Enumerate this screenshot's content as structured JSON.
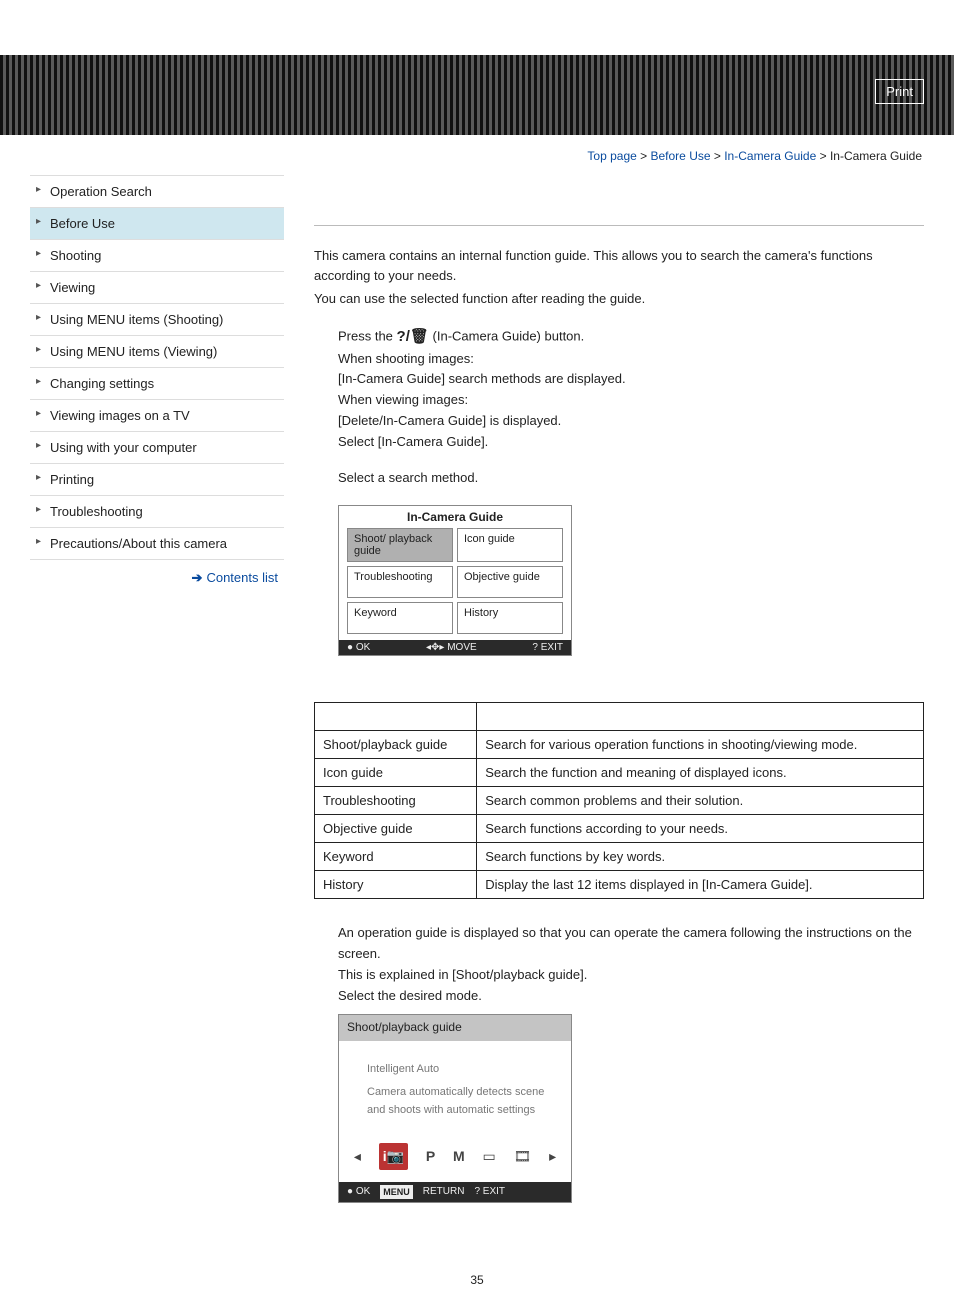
{
  "header": {
    "print": "Print"
  },
  "breadcrumb": {
    "items": [
      "Top page",
      "Before Use",
      "In-Camera Guide"
    ],
    "current": "In-Camera Guide",
    "sep": " > "
  },
  "sidebar": {
    "items": [
      "Operation Search",
      "Before Use",
      "Shooting",
      "Viewing",
      "Using MENU items (Shooting)",
      "Using MENU items (Viewing)",
      "Changing settings",
      "Viewing images on a TV",
      "Using with your computer",
      "Printing",
      "Troubleshooting",
      "Precautions/About this camera"
    ],
    "active_index": 1,
    "contents_list": "Contents list"
  },
  "intro": {
    "p1": "This camera contains an internal function guide. This allows you to search the camera's functions according to your needs.",
    "p2": "You can use the selected function after reading the guide."
  },
  "step1": {
    "l1a": "Press the ",
    "l1b": " (In-Camera Guide) button.",
    "l2": "When shooting images:",
    "l3": "[In-Camera Guide] search methods are displayed.",
    "l4": "When viewing images:",
    "l5": "[Delete/In-Camera Guide] is displayed.",
    "l6": "Select [In-Camera Guide]."
  },
  "step2": {
    "l1": "Select a search method."
  },
  "screenshot1": {
    "title": "In-Camera Guide",
    "cells": [
      "Shoot/ playback guide",
      "Icon guide",
      "Troubleshooting",
      "Objective guide",
      "Keyword",
      "History"
    ],
    "footer": {
      "ok": "● OK",
      "move": "◂✥▸ MOVE",
      "exit": "? EXIT"
    }
  },
  "guide_table": {
    "rows": [
      {
        "name": "Shoot/playback guide",
        "desc": "Search for various operation functions in shooting/viewing mode."
      },
      {
        "name": "Icon guide",
        "desc": "Search the function and meaning of displayed icons."
      },
      {
        "name": "Troubleshooting",
        "desc": "Search common problems and their solution."
      },
      {
        "name": "Objective guide",
        "desc": "Search functions according to your needs."
      },
      {
        "name": "Keyword",
        "desc": "Search functions by key words."
      },
      {
        "name": "History",
        "desc": "Display the last 12 items displayed in [In-Camera Guide]."
      }
    ]
  },
  "bottom": {
    "p1": "An operation guide is displayed so that you can operate the camera following the instructions on the screen.",
    "p2": "This is explained in [Shoot/playback guide].",
    "p3": "Select the desired mode."
  },
  "screenshot2": {
    "title": "Shoot/playback guide",
    "mode": "Intelligent Auto",
    "desc": "Camera automatically detects scene and shoots with automatic settings",
    "footer": {
      "ok": "● OK",
      "menu": "MENU",
      "return": "RETURN",
      "exit": "? EXIT"
    }
  },
  "pagenum": "35"
}
